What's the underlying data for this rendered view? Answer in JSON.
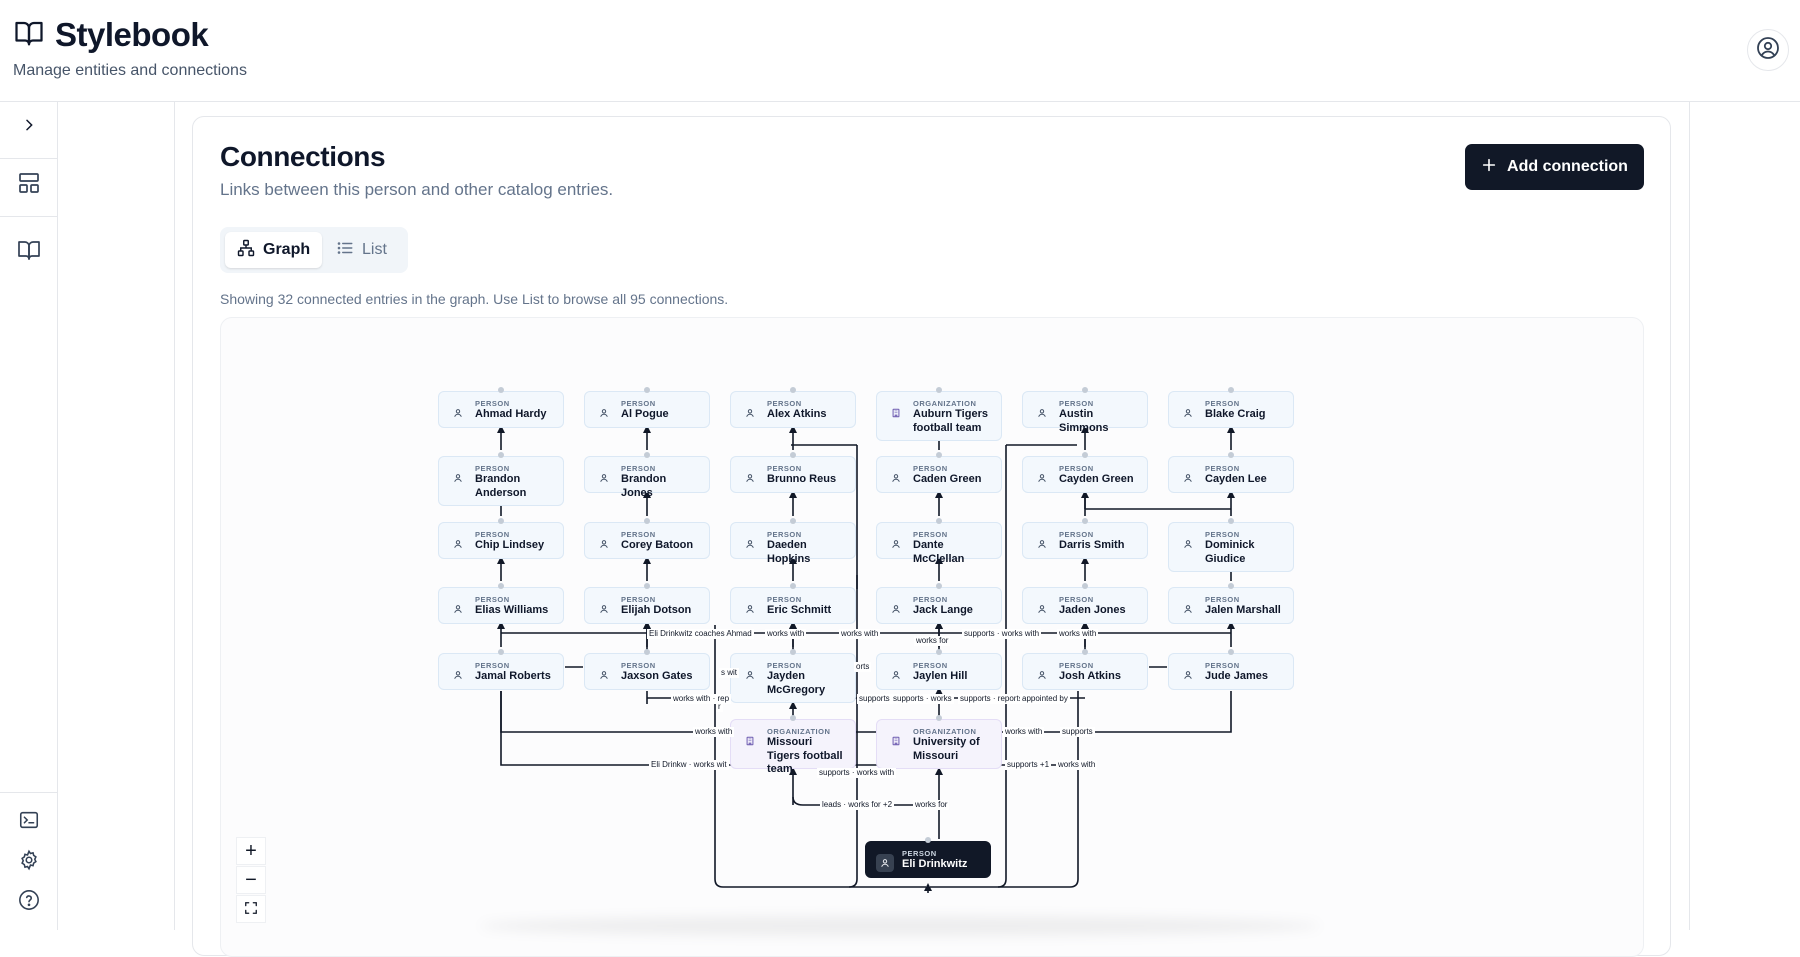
{
  "app": {
    "title": "Stylebook",
    "subtitle": "Manage entities and connections"
  },
  "sidebar": {
    "items": [
      {
        "icon": "chevron-right-icon"
      },
      {
        "icon": "layout-icon"
      },
      {
        "icon": "book-icon"
      },
      {
        "icon": "terminal-icon"
      },
      {
        "icon": "gear-icon"
      },
      {
        "icon": "help-icon"
      }
    ]
  },
  "connections": {
    "title": "Connections",
    "subtitle": "Links between this person and other catalog entries.",
    "add_label": "Add connection",
    "tabs": [
      {
        "label": "Graph",
        "active": true
      },
      {
        "label": "List",
        "active": false
      }
    ],
    "info": "Showing 32 connected entries in the graph. Use List to browse all 95 connections."
  },
  "graph": {
    "nodes": [
      {
        "type": "PERSON",
        "name": "Ahmad Hardy"
      },
      {
        "type": "PERSON",
        "name": "Al Pogue"
      },
      {
        "type": "PERSON",
        "name": "Alex Atkins"
      },
      {
        "type": "ORGANIZATION",
        "name": "Auburn Tigers football team"
      },
      {
        "type": "PERSON",
        "name": "Austin Simmons"
      },
      {
        "type": "PERSON",
        "name": "Blake Craig"
      },
      {
        "type": "PERSON",
        "name": "Brandon Anderson"
      },
      {
        "type": "PERSON",
        "name": "Brandon Jones"
      },
      {
        "type": "PERSON",
        "name": "Brunno Reus"
      },
      {
        "type": "PERSON",
        "name": "Caden Green"
      },
      {
        "type": "PERSON",
        "name": "Cayden Green"
      },
      {
        "type": "PERSON",
        "name": "Cayden Lee"
      },
      {
        "type": "PERSON",
        "name": "Chip Lindsey"
      },
      {
        "type": "PERSON",
        "name": "Corey Batoon"
      },
      {
        "type": "PERSON",
        "name": "Daeden Hopkins"
      },
      {
        "type": "PERSON",
        "name": "Dante McClellan"
      },
      {
        "type": "PERSON",
        "name": "Darris Smith"
      },
      {
        "type": "PERSON",
        "name": "Dominick Giudice"
      },
      {
        "type": "PERSON",
        "name": "Elias Williams"
      },
      {
        "type": "PERSON",
        "name": "Elijah Dotson"
      },
      {
        "type": "PERSON",
        "name": "Eric Schmitt"
      },
      {
        "type": "PERSON",
        "name": "Jack Lange"
      },
      {
        "type": "PERSON",
        "name": "Jaden Jones"
      },
      {
        "type": "PERSON",
        "name": "Jalen Marshall"
      },
      {
        "type": "PERSON",
        "name": "Jamal Roberts"
      },
      {
        "type": "PERSON",
        "name": "Jaxson Gates"
      },
      {
        "type": "PERSON",
        "name": "Jayden McGregory"
      },
      {
        "type": "PERSON",
        "name": "Jaylen Hill"
      },
      {
        "type": "PERSON",
        "name": "Josh Atkins"
      },
      {
        "type": "PERSON",
        "name": "Jude James"
      },
      {
        "type": "ORGANIZATION",
        "name": "Missouri Tigers football team"
      },
      {
        "type": "ORGANIZATION",
        "name": "University of Missouri"
      },
      {
        "type": "PERSON",
        "name": "Eli Drinkwitz"
      }
    ],
    "edge_labels": [
      "Eli Drinkwitz coaches Ahmad",
      "works with",
      "works with",
      "supports · works with",
      "works with",
      "works for",
      "orts",
      "s wit",
      "r",
      "works with · rep",
      "supports",
      "supports · works",
      "supports · reports to +",
      "appointed by",
      "works with",
      "works with",
      "supports",
      "Eli Drinkw · works wit",
      "supports · works with",
      "supports +1",
      "works with",
      "leads · works for +2",
      "works for"
    ],
    "zoom_controls": [
      "+",
      "−",
      "⛶"
    ]
  }
}
